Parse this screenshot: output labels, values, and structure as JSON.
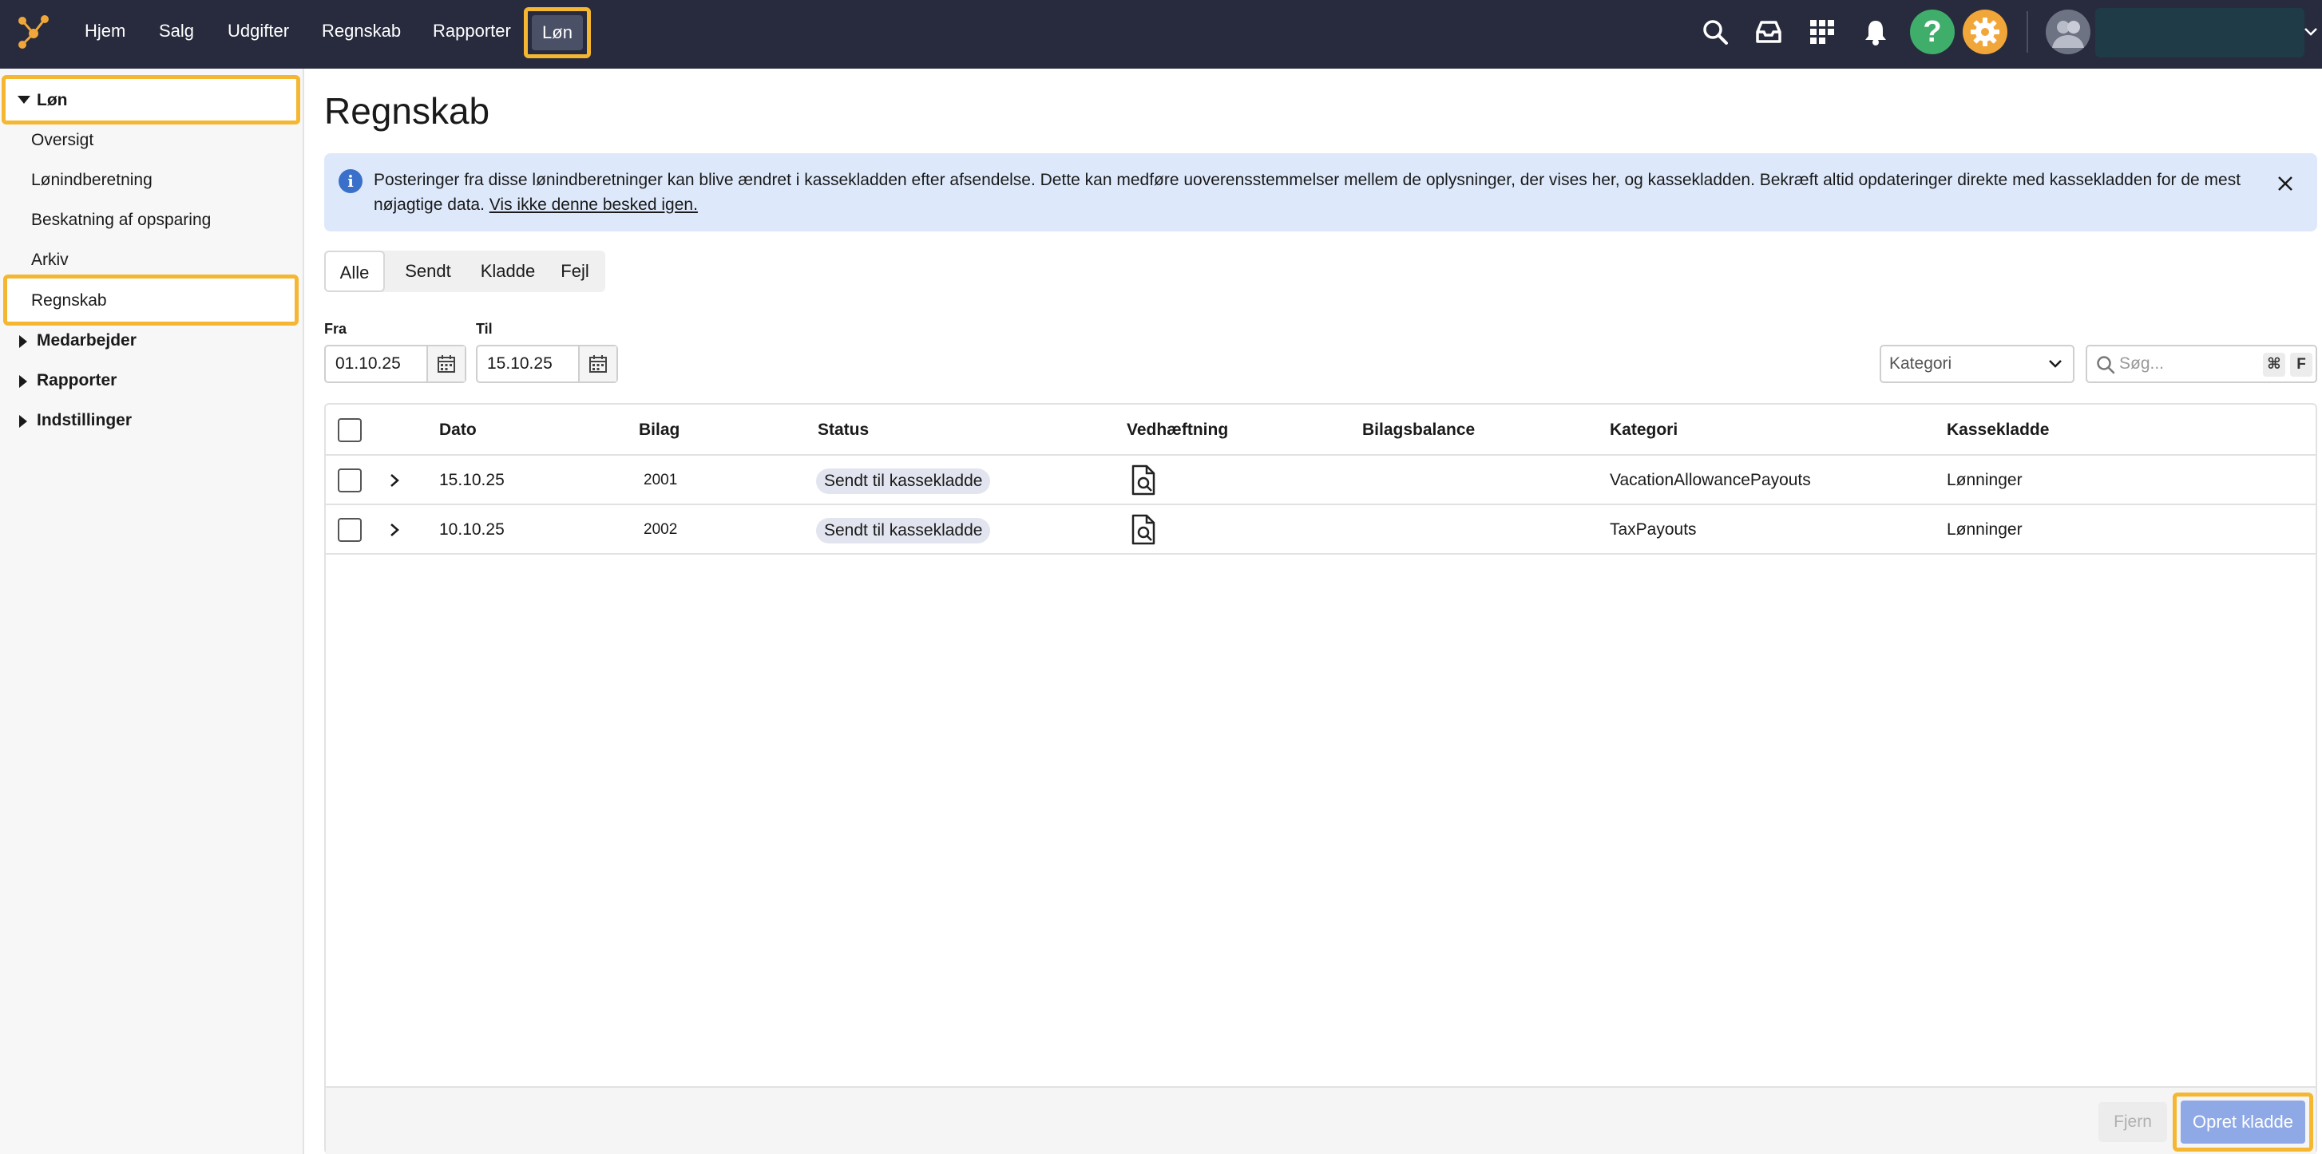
{
  "topbar": {
    "nav": [
      {
        "label": "Hjem"
      },
      {
        "label": "Salg"
      },
      {
        "label": "Udgifter"
      },
      {
        "label": "Regnskab"
      },
      {
        "label": "Rapporter"
      },
      {
        "label": "Løn"
      }
    ],
    "icons": [
      "search-icon",
      "inbox-icon",
      "apps-grid-icon",
      "bell-icon",
      "help-icon",
      "gear-icon",
      "avatar"
    ],
    "help_label": "?"
  },
  "sidebar": {
    "section_lon": "Løn",
    "items": [
      {
        "label": "Oversigt"
      },
      {
        "label": "Lønindberetning"
      },
      {
        "label": "Beskatning af opsparing"
      },
      {
        "label": "Arkiv"
      },
      {
        "label": "Regnskab"
      }
    ],
    "collapsed_sections": [
      {
        "label": "Medarbejder"
      },
      {
        "label": "Rapporter"
      },
      {
        "label": "Indstillinger"
      }
    ]
  },
  "main": {
    "title": "Regnskab",
    "info": {
      "text": "Posteringer fra disse lønindberetninger kan blive ændret i kassekladden efter afsendelse. Dette kan medføre uoverensstemmelser mellem de oplysninger, der vises her, og kassekladden. Bekræft altid opdateringer direkte med kassekladden for de mest nøjagtige data.",
      "link": "Vis ikke denne besked igen.",
      "icon_label": "i"
    },
    "tabs": [
      {
        "label": "Alle"
      },
      {
        "label": "Sendt"
      },
      {
        "label": "Kladde"
      },
      {
        "label": "Fejl"
      }
    ],
    "filters": {
      "from_label": "Fra",
      "from_value": "01.10.25",
      "to_label": "Til",
      "to_value": "15.10.25",
      "category_value": "Kategori",
      "search_placeholder": "Søg...",
      "kbd_cmd": "⌘",
      "kbd_key": "F"
    },
    "table": {
      "columns": [
        "Dato",
        "Bilag",
        "Status",
        "Vedhæftning",
        "Bilagsbalance",
        "Kategori",
        "Kassekladde"
      ],
      "rows": [
        {
          "dato": "15.10.25",
          "bilag": "2001",
          "status": "Sendt til kassekladde",
          "kategori": "VacationAllowancePayouts",
          "kassekladde": "Lønninger"
        },
        {
          "dato": "10.10.25",
          "bilag": "2002",
          "status": "Sendt til kassekladde",
          "kategori": "TaxPayouts",
          "kassekladde": "Lønninger"
        }
      ]
    },
    "footer": {
      "remove_label": "Fjern",
      "create_label": "Opret kladde"
    }
  },
  "colors": {
    "topbar": "#272b3d",
    "highlight": "#f5b731",
    "info_bg": "#dde9fb",
    "help_green": "#3fae6b",
    "gear_orange": "#f1a63a",
    "primary_button": "#8fa9e6"
  }
}
